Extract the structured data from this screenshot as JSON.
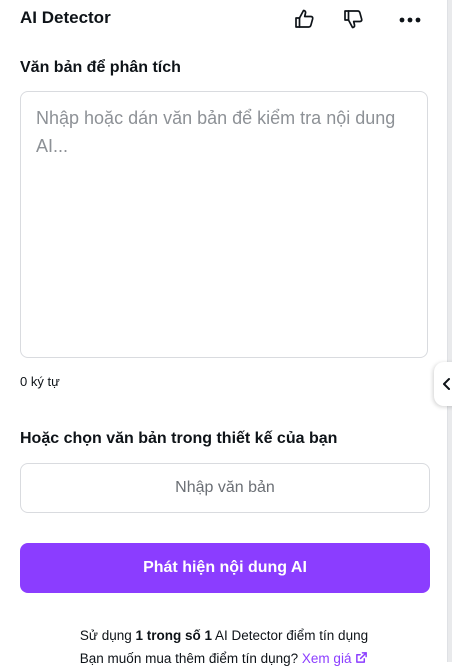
{
  "colors": {
    "accent": "#8b3dff"
  },
  "header": {
    "title": "AI Detector",
    "icons": [
      "thumbs-up-icon",
      "thumbs-down-icon",
      "more-icon"
    ]
  },
  "text_section": {
    "label": "Văn bản để phân tích",
    "placeholder": "Nhập hoặc dán văn bản để kiểm tra nội dung AI...",
    "char_count": "0 ký tự"
  },
  "design_section": {
    "label": "Hoặc chọn văn bản trong thiết kế của bạn",
    "input_button_label": "Nhập văn bản"
  },
  "detect_button_label": "Phát hiện nội dung AI",
  "footer": {
    "usage_prefix": "Sử dụng ",
    "usage_bold": "1 trong số 1",
    "usage_suffix": " AI Detector điểm tín dụng",
    "buy_prefix": "Bạn muốn mua thêm điểm tín dụng? ",
    "buy_link": "Xem giá"
  }
}
